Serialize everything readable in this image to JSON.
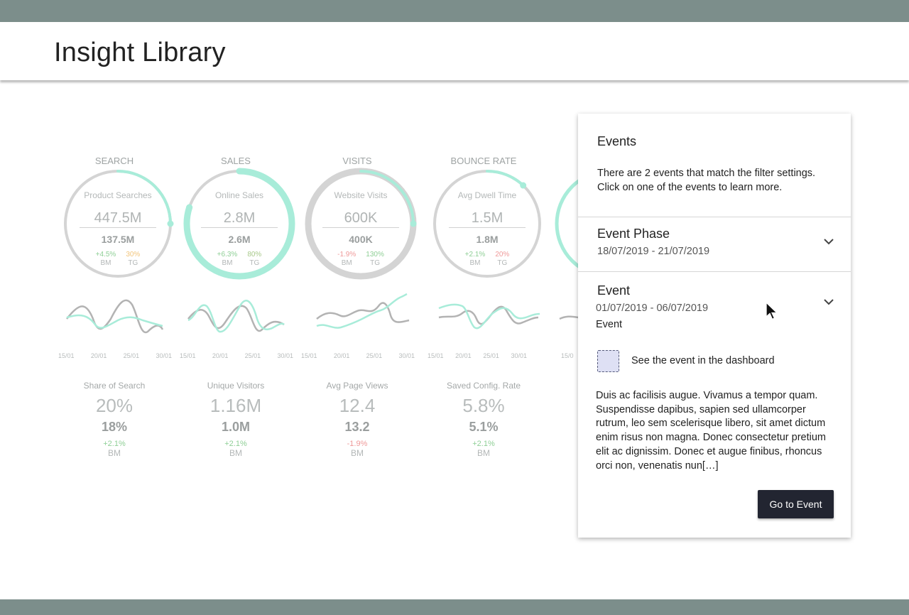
{
  "header": {
    "title": "Insight Library"
  },
  "kpis": [
    {
      "category": "SEARCH",
      "ring_label": "Product Searches",
      "main": "447.5M",
      "second": "137.5M",
      "progress": 0.25,
      "deltas": [
        {
          "value": "+4.5%",
          "label": "BM",
          "tone": "pos"
        },
        {
          "value": "30%",
          "label": "TG",
          "tone": "warn"
        }
      ]
    },
    {
      "category": "SALES",
      "ring_label": "Online Sales",
      "main": "2.8M",
      "second": "2.6M",
      "progress": 0.8,
      "deltas": [
        {
          "value": "+6.3%",
          "label": "BM",
          "tone": "pos"
        },
        {
          "value": "80%",
          "label": "TG",
          "tone": "pos"
        }
      ]
    },
    {
      "category": "VISITS",
      "ring_label": "Website Visits",
      "main": "600K",
      "second": "400K",
      "progress": 0.25,
      "deltas": [
        {
          "value": "-1.9%",
          "label": "BM",
          "tone": "neg"
        },
        {
          "value": "130%",
          "label": "TG",
          "tone": "pos"
        }
      ]
    },
    {
      "category": "BOUNCE RATE",
      "ring_label": "Avg Dwell Time",
      "main": "1.5M",
      "second": "1.8M",
      "progress": 0.12,
      "deltas": [
        {
          "value": "+2.1%",
          "label": "BM",
          "tone": "pos"
        },
        {
          "value": "20%",
          "label": "TG",
          "tone": "neg"
        }
      ]
    }
  ],
  "sparkline_ticks": [
    "15/01",
    "20/01",
    "25/01",
    "30/01"
  ],
  "metrics": [
    {
      "label": "Share of Search",
      "main": "20%",
      "second": "18%",
      "delta": "+2.1%",
      "delta_tone": "pos",
      "delta_label": "BM"
    },
    {
      "label": "Unique Visitors",
      "main": "1.16M",
      "second": "1.0M",
      "delta": "+2.1%",
      "delta_tone": "pos",
      "delta_label": "BM"
    },
    {
      "label": "Avg Page Views",
      "main": "12.4",
      "second": "13.2",
      "delta": "-1.9%",
      "delta_tone": "neg",
      "delta_label": "BM"
    },
    {
      "label": "Saved Config. Rate",
      "main": "5.8%",
      "second": "5.1%",
      "delta": "+2.1%",
      "delta_tone": "pos",
      "delta_label": "BM"
    }
  ],
  "partial_tick": "15/0",
  "panel": {
    "title": "Events",
    "intro": "There are 2 events that match the filter settings. Click on one of the events to learn more.",
    "phase": {
      "title": "Event Phase",
      "date": "18/07/2019 - 21/07/2019"
    },
    "event": {
      "title": "Event",
      "date": "01/07/2019 - 06/07/2019",
      "type": "Event",
      "dashboard_link": "See the event in the dashboard",
      "body": "Duis ac facilisis augue. Vivamus a tempor quam. Suspendisse dapibus, sapien sed ullamcorper rutrum, leo sem scelerisque libero, sit amet dictum enim risus non magna. Donec consectetur pretium elit ac dignissim. Donec et augue finibus, rhoncus orci non, venenatis nun[…]",
      "button": "Go to Event"
    }
  },
  "colors": {
    "accent": "#a8ecd9",
    "ring_track": "#d4d4d4",
    "button": "#222531",
    "bar": "#7c8e8b"
  }
}
